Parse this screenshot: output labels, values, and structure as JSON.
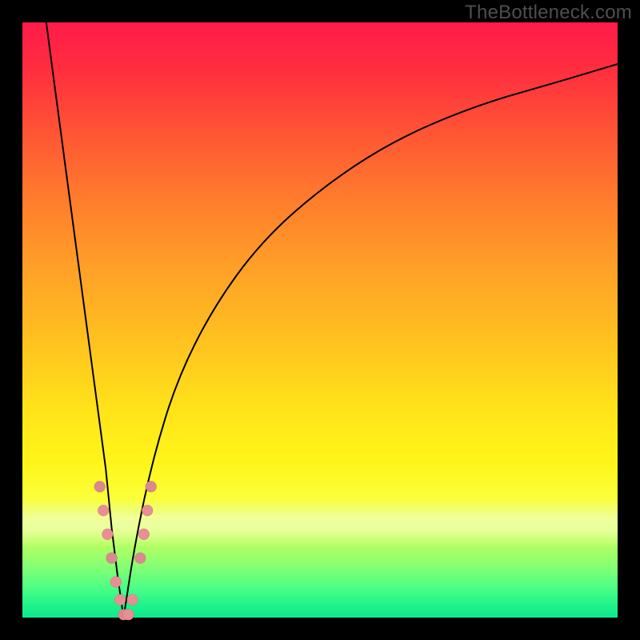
{
  "watermark": "TheBottleneck.com",
  "colors": {
    "frame": "#000000",
    "watermark_text": "#4e4e4e",
    "curve": "#000000",
    "marker": "#e98e94",
    "gradient_top": "#ff1b4a",
    "gradient_bottom": "#0fe88d"
  },
  "chart_data": {
    "type": "line",
    "title": "",
    "xlabel": "",
    "ylabel": "",
    "xlim": [
      0,
      100
    ],
    "ylim": [
      0,
      100
    ],
    "notes": "Bottleneck-percentage-style V-curve. Left branch is steep linear descent from top; right branch rises like a log/sqrt toward upper right. Minimum (0% bottleneck) near x≈17. Pink markers cluster near the minimum on both branches.",
    "series": [
      {
        "name": "left-branch",
        "x": [
          4,
          6,
          8,
          10,
          12,
          14,
          15,
          16,
          17
        ],
        "y": [
          100,
          85,
          70,
          55,
          40,
          25,
          15,
          7,
          0
        ]
      },
      {
        "name": "right-branch",
        "x": [
          17,
          19,
          22,
          26,
          32,
          40,
          50,
          62,
          76,
          90,
          100
        ],
        "y": [
          0,
          13,
          27,
          40,
          52,
          63,
          72,
          80,
          86,
          90,
          93
        ]
      }
    ],
    "markers": [
      {
        "x": 13.0,
        "y": 22
      },
      {
        "x": 13.6,
        "y": 18
      },
      {
        "x": 14.3,
        "y": 14
      },
      {
        "x": 15.0,
        "y": 10
      },
      {
        "x": 15.7,
        "y": 6
      },
      {
        "x": 16.4,
        "y": 3
      },
      {
        "x": 17.0,
        "y": 0.5
      },
      {
        "x": 17.8,
        "y": 0.5
      },
      {
        "x": 18.5,
        "y": 3
      },
      {
        "x": 19.8,
        "y": 10
      },
      {
        "x": 20.4,
        "y": 14
      },
      {
        "x": 21.0,
        "y": 18
      },
      {
        "x": 21.6,
        "y": 22
      }
    ]
  }
}
